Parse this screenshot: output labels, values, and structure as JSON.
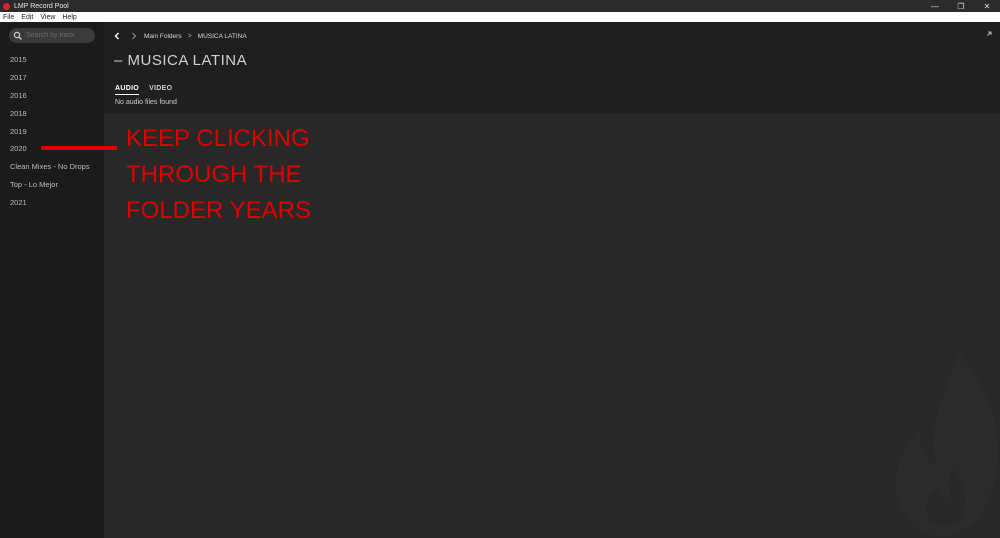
{
  "window": {
    "title": "LMP Record Pool",
    "controls": {
      "minimize": "—",
      "restore": "❐",
      "close": "✕"
    }
  },
  "menu": [
    "File",
    "Edit",
    "View",
    "Help"
  ],
  "sidebar": {
    "search_placeholder": "Search by track",
    "items": [
      "2015",
      "2017",
      "2016",
      "2018",
      "2019",
      "2020",
      "Clean Mixes - No Drops",
      "Top - Lo Mejor",
      "2021"
    ]
  },
  "header": {
    "breadcrumb": {
      "root": "Main Folders",
      "separator": ">",
      "current": "MUSICA LATINA"
    },
    "title": "– MUSICA LATINA",
    "tabs": [
      "AUDIO",
      "VIDEO"
    ],
    "active_tab": "AUDIO",
    "empty_message": "No audio files found"
  },
  "annotation": {
    "text": "KEEP CLICKING\nTHROUGH THE\nFOLDER YEARS",
    "color": "#e00000"
  },
  "icons": {
    "back": "chevron-left-icon",
    "forward": "chevron-right-icon",
    "search": "search-icon",
    "expand": "expand-icon",
    "watermark": "flame-logo"
  }
}
